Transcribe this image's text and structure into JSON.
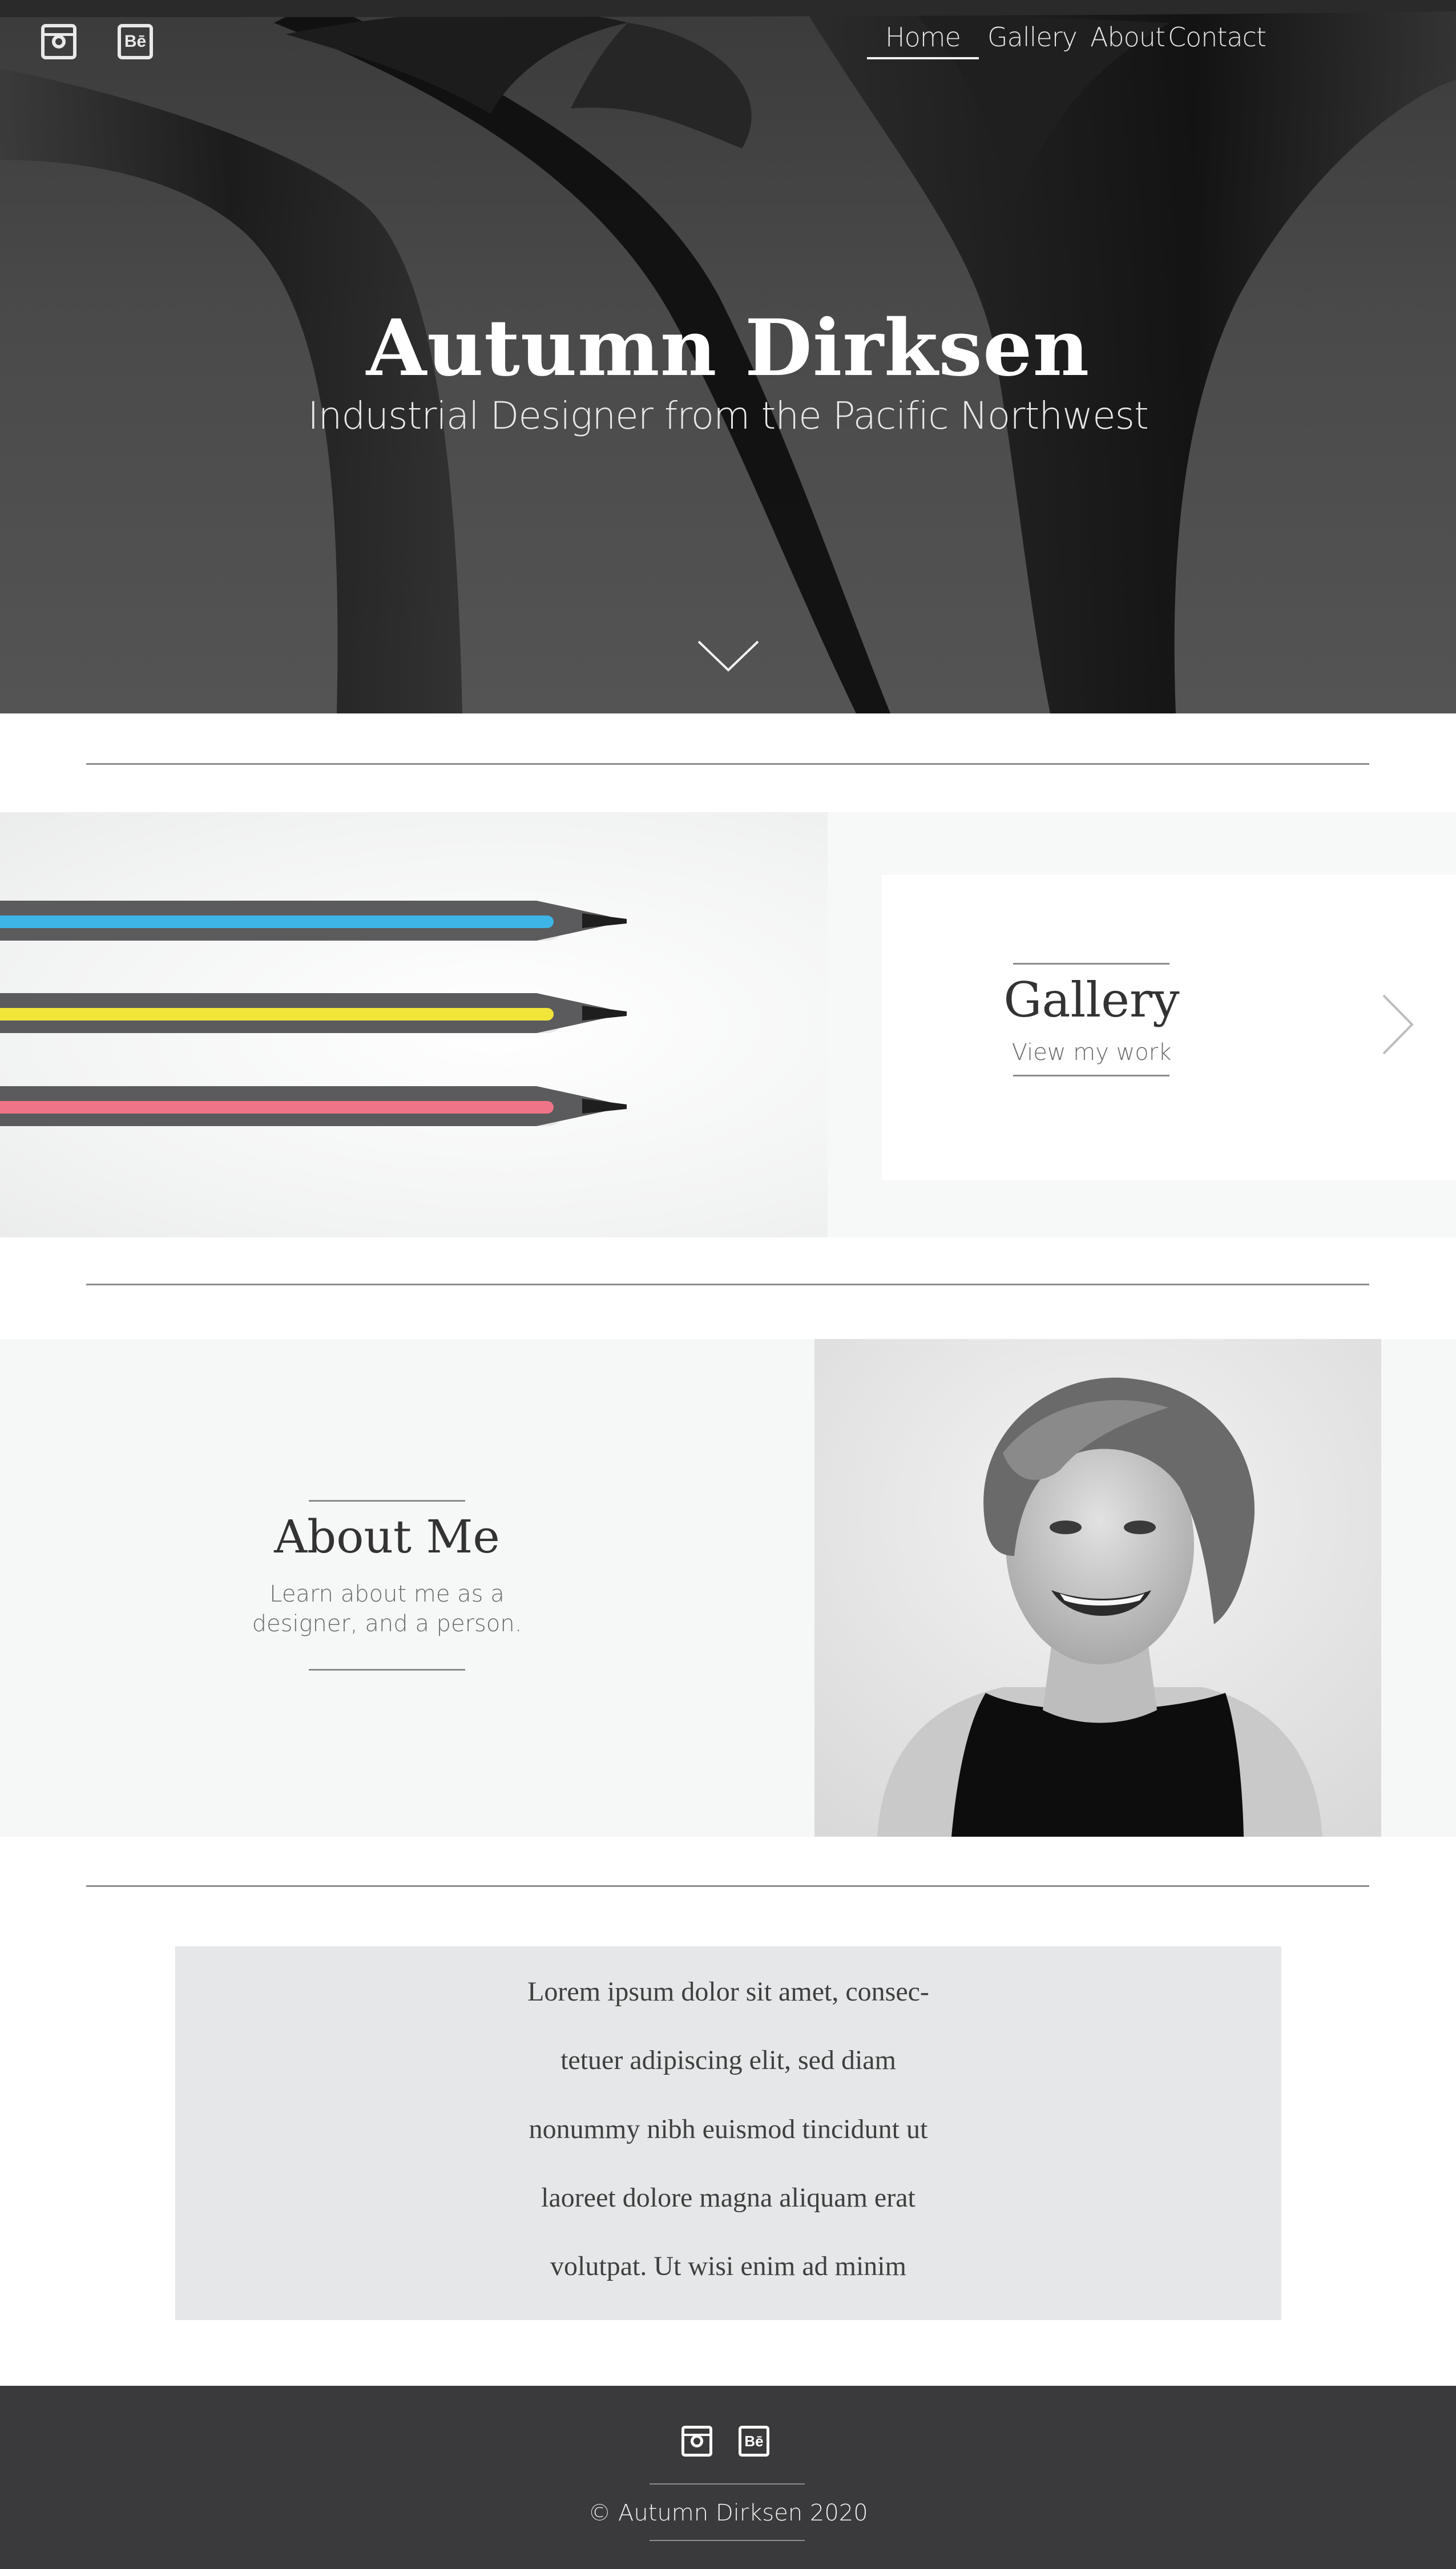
{
  "header": {
    "social": [
      {
        "icon": "instagram-icon"
      },
      {
        "icon": "behance-icon",
        "glyph": "Bē"
      }
    ],
    "nav": [
      {
        "label": "Home",
        "active": true
      },
      {
        "label": "Gallery",
        "active": false
      },
      {
        "label": "About",
        "active": false
      },
      {
        "label": "Contact",
        "active": false
      }
    ]
  },
  "hero": {
    "title": "Autumn Dirksen",
    "subtitle": "Industrial Designer from the Pacific Northwest",
    "scroll_icon": "chevron-down-icon"
  },
  "gallery": {
    "title": "Gallery",
    "subtitle": "View my work",
    "next_icon": "chevron-right-icon",
    "pencil_colors": [
      "#3db5e6",
      "#f2e53a",
      "#ef7487"
    ]
  },
  "about": {
    "title": "About Me",
    "line1": "Learn about me as a",
    "line2": "designer, and a person."
  },
  "quote": {
    "lines": [
      "Lorem ipsum dolor sit amet, consec-",
      "tetuer adipiscing elit, sed diam",
      "nonummy nibh euismod tincidunt ut",
      "laoreet dolore magna aliquam erat",
      "volutpat. Ut wisi enim ad minim"
    ]
  },
  "footer": {
    "social": [
      {
        "icon": "instagram-icon"
      },
      {
        "icon": "behance-icon",
        "glyph": "Bē"
      }
    ],
    "copyright": "© Autumn Dirksen 2020"
  },
  "colors": {
    "hero_bg": "#4a4a4a",
    "footer_bg": "#3a3a3c",
    "quote_bg": "#e6e7e8",
    "band_bg": "#f6f7f7",
    "rule": "#8c8c8c"
  }
}
